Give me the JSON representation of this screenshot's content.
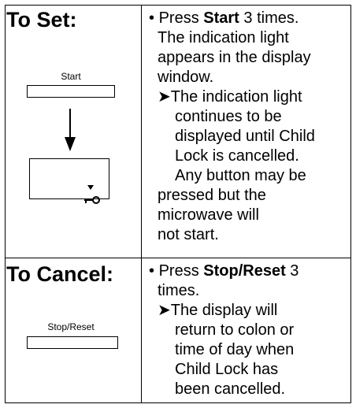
{
  "set": {
    "title": "To Set:",
    "button_label": "Start",
    "lines": [
      {
        "bullet": "•",
        "pre": "Press ",
        "bold": "Start",
        "post": " 3 times."
      },
      {
        "text": "The indication light"
      },
      {
        "text": "appears in the display"
      },
      {
        "text": "window."
      },
      {
        "arrow": "➤",
        "text": "The indication light"
      },
      {
        "text": "continues to be"
      },
      {
        "text": "displayed until Child"
      },
      {
        "text": "Lock is cancelled."
      },
      {
        "text": "Any button may be"
      },
      {
        "text": "pressed but the"
      },
      {
        "text": "microwave will"
      },
      {
        "text": "not start."
      }
    ]
  },
  "cancel": {
    "title": "To Cancel:",
    "button_label": "Stop/Reset",
    "lines": [
      {
        "bullet": "•",
        "pre": "Press ",
        "bold": "Stop/Reset",
        "post": " 3"
      },
      {
        "text": "times."
      },
      {
        "arrow": "➤",
        "text": "The display will"
      },
      {
        "text": "return to colon or"
      },
      {
        "text": "time of day when"
      },
      {
        "text": "Child Lock has"
      },
      {
        "text": "been cancelled."
      }
    ]
  },
  "icons": {
    "down_arrow": "down-arrow-icon",
    "key": "key-icon",
    "indicator": "indicator-triangle-icon"
  }
}
